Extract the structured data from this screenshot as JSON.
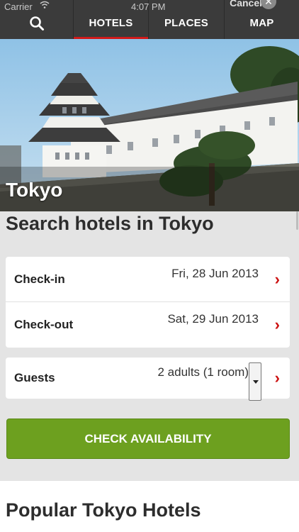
{
  "status": {
    "carrier": "Carrier",
    "time": "4:07 PM",
    "cancel": "Cancel"
  },
  "nav": {
    "hotels": "HOTELS",
    "places": "PLACES",
    "map": "MAP"
  },
  "hero": {
    "city": "Tokyo"
  },
  "search": {
    "title": "Search hotels in Tokyo"
  },
  "dates": {
    "checkin_label": "Check-in",
    "checkin_value": "Fri, 28 Jun 2013",
    "checkout_label": "Check-out",
    "checkout_value": "Sat, 29 Jun 2013"
  },
  "guests": {
    "label": "Guests",
    "value": "2 adults (1 room)"
  },
  "cta": {
    "label": "CHECK AVAILABILITY"
  },
  "popular": {
    "title": "Popular Tokyo Hotels"
  },
  "colors": {
    "accent": "#d11a1a",
    "cta": "#6da01f",
    "navbar": "#3b3b3b"
  }
}
